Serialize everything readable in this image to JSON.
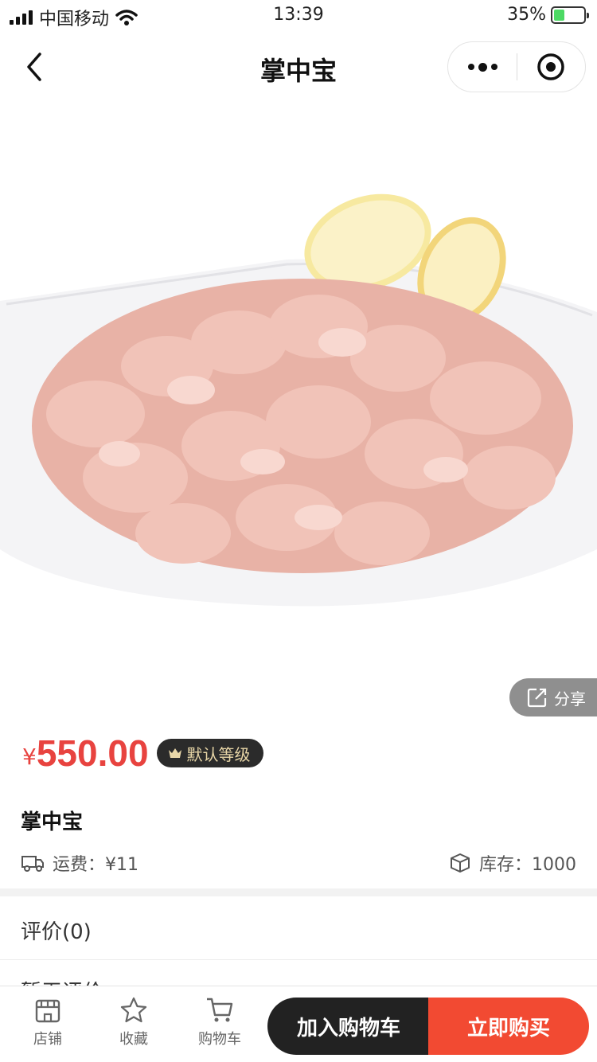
{
  "status_bar": {
    "carrier": "中国移动",
    "time": "13:39",
    "battery": "35%",
    "battery_level": 0.35
  },
  "nav": {
    "title": "掌中宝"
  },
  "product": {
    "image_icon": "chicken-cartilage-plate-icon",
    "share_label": "分享",
    "price_symbol": "¥",
    "price": "550.00",
    "level_badge": "默认等级",
    "title": "掌中宝",
    "shipping": "运费：¥11",
    "stock": "库存：1000"
  },
  "reviews": {
    "header": "评价(0)",
    "empty_text": "暂无评价"
  },
  "bottom_bar": {
    "tabs": [
      {
        "label": "店铺",
        "icon": "store-icon"
      },
      {
        "label": "收藏",
        "icon": "star-icon"
      },
      {
        "label": "购物车",
        "icon": "cart-icon"
      }
    ],
    "add_to_cart": "加入购物车",
    "buy_now": "立即购买"
  },
  "colors": {
    "price": "#e8433f",
    "buy": "#f24a32",
    "cart_btn": "#222222",
    "badge_text": "#e9d7a8"
  }
}
